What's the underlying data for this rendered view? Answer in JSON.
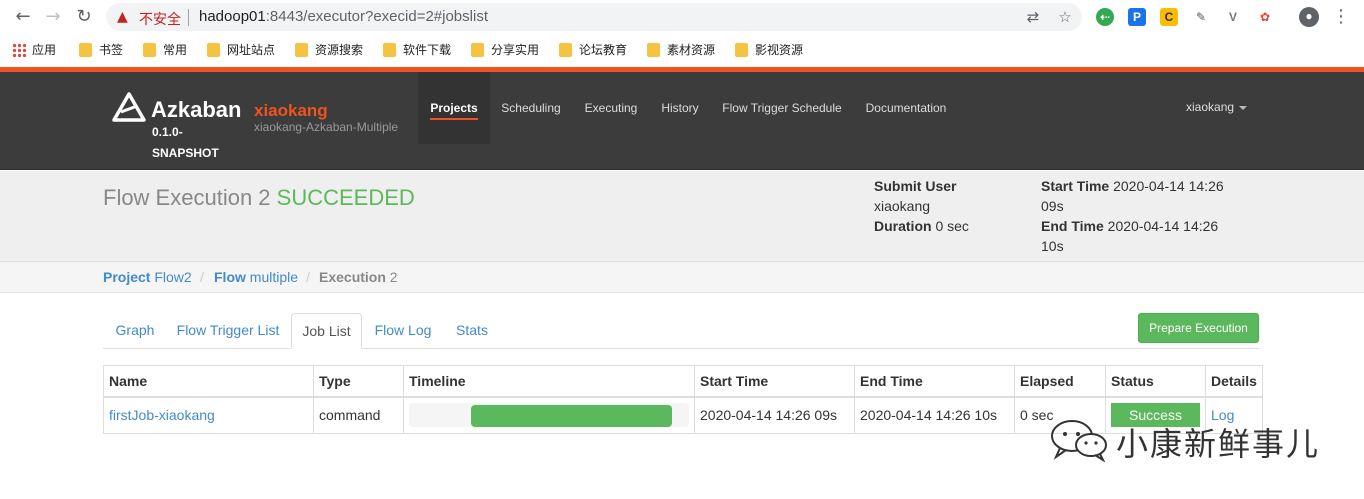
{
  "browser": {
    "insecure_label": "不安全",
    "url_host": "hadoop01",
    "url_path": ":8443/executor?execid=2#jobslist",
    "bookmarks": [
      "应用",
      "书签",
      "常用",
      "网址站点",
      "资源搜索",
      "软件下载",
      "分享实用",
      "论坛教育",
      "素材资源",
      "影视资源"
    ]
  },
  "azkaban": {
    "brand": "Azkaban",
    "version": "0.1.0-SNAPSHOT",
    "env_name": "xiaokang",
    "env_desc": "xiaokang-Azkaban-Multiple",
    "nav": [
      "Projects",
      "Scheduling",
      "Executing",
      "History",
      "Flow Trigger Schedule",
      "Documentation"
    ],
    "active_nav": "Projects",
    "user": "xiaokang"
  },
  "execution": {
    "title": "Flow Execution 2",
    "status": "SUCCEEDED",
    "submit_user_label": "Submit User",
    "submit_user": "xiaokang",
    "duration_label": "Duration",
    "duration": "0 sec",
    "start_time_label": "Start Time",
    "start_time": "2020-04-14 14:26 09s",
    "end_time_label": "End Time",
    "end_time": "2020-04-14 14:26 10s"
  },
  "breadcrumb": {
    "project_label": "Project",
    "project": "Flow2",
    "flow_label": "Flow",
    "flow": "multiple",
    "execution_label": "Execution",
    "execution": "2"
  },
  "tabs": [
    "Graph",
    "Flow Trigger List",
    "Job List",
    "Flow Log",
    "Stats"
  ],
  "active_tab": "Job List",
  "prepare_button": "Prepare Execution",
  "job_table": {
    "headers": [
      "Name",
      "Type",
      "Timeline",
      "Start Time",
      "End Time",
      "Elapsed",
      "Status",
      "Details"
    ],
    "rows": [
      {
        "name": "firstJob-xiaokang",
        "type": "command",
        "timeline_start_fraction": 0.22,
        "timeline_end_fraction": 0.94,
        "start_time": "2020-04-14 14:26 09s",
        "end_time": "2020-04-14 14:26 10s",
        "elapsed": "0 sec",
        "status": "Success",
        "details": "Log"
      }
    ]
  },
  "watermark": "小康新鲜事儿",
  "colors": {
    "accent": "#f0531f",
    "success": "#5cb85c",
    "link": "#428bca"
  }
}
